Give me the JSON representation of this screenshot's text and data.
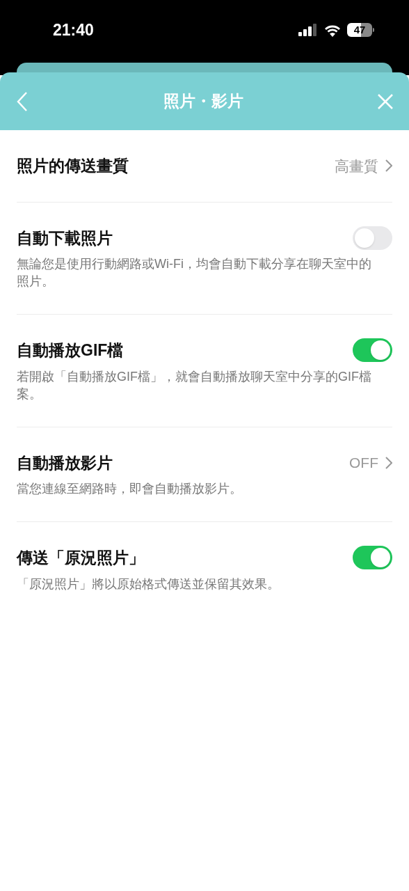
{
  "status_bar": {
    "time": "21:40",
    "battery": "47"
  },
  "header": {
    "title": "照片・影片"
  },
  "settings": [
    {
      "kind": "link",
      "title": "照片的傳送畫質",
      "value": "高畫質"
    },
    {
      "kind": "toggle",
      "title": "自動下載照片",
      "description": "無論您是使用行動網路或Wi-Fi，均會自動下載分享在聊天室中的照片。",
      "on": false
    },
    {
      "kind": "toggle",
      "title": "自動播放GIF檔",
      "description": "若開啟「自動播放GIF檔」，就會自動播放聊天室中分享的GIF檔案。",
      "on": true
    },
    {
      "kind": "link",
      "title": "自動播放影片",
      "description": "當您連線至網路時，即會自動播放影片。",
      "value": "OFF"
    },
    {
      "kind": "toggle",
      "title": "傳送「原況照片」",
      "description": "「原況照片」將以原始格式傳送並保留其效果。",
      "on": true
    }
  ]
}
